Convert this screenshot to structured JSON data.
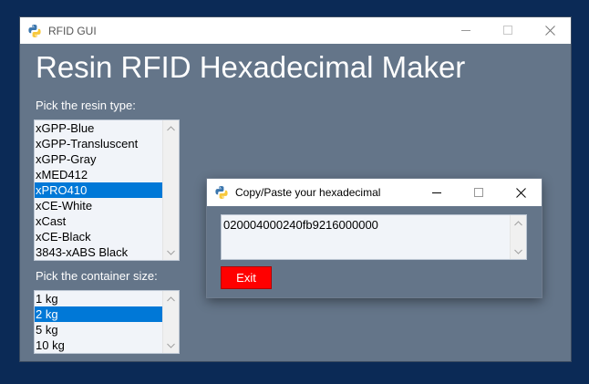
{
  "main_window": {
    "title": "RFID GUI",
    "heading": "Resin RFID Hexadecimal Maker",
    "resin_label": "Pick the resin type:",
    "resin_items": [
      "xGPP-Blue",
      "xGPP-Transluscent",
      "xGPP-Gray",
      "xMED412",
      "xPRO410",
      "xCE-White",
      "xCast",
      "xCE-Black",
      "3843-xABS Black"
    ],
    "resin_selected": "xPRO410",
    "container_label": "Pick the container size:",
    "container_items": [
      "1 kg",
      "2 kg",
      "5 kg",
      "10 kg"
    ],
    "container_selected": "2 kg"
  },
  "dialog": {
    "title": "Copy/Paste your hexadecimal",
    "hex_value": "020004000240fb9216000000",
    "exit_label": "Exit"
  },
  "colors": {
    "selection": "#0078d7",
    "exit_button": "#ff0000",
    "window_bg": "#647589",
    "desktop": "#0b2a56"
  }
}
